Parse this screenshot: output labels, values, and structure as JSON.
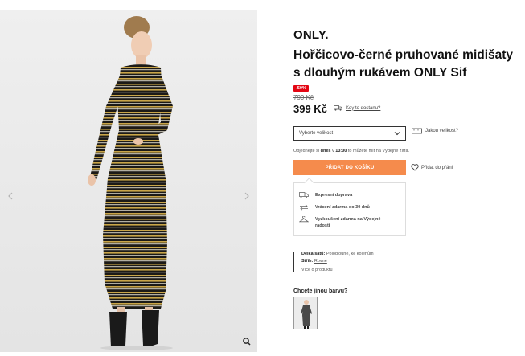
{
  "gallery": {
    "prev_icon": "chevron-left-icon",
    "next_icon": "chevron-right-icon",
    "zoom_icon": "magnifier-icon"
  },
  "product": {
    "brand": "ONLY.",
    "title": "Hořčicovo-černé pruhované midišaty s dlouhým rukávem ONLY Sif",
    "discount_badge": "-50%",
    "old_price": "799 Kč",
    "price": "399 Kč",
    "delivery_link": "Kdy to dostanu?"
  },
  "size": {
    "placeholder": "Vyberte velikost",
    "guide_link": "Jakou velikost?"
  },
  "order_note": {
    "prefix": "Objednejte si ",
    "today": "dnes",
    "middle": " v ",
    "time": "13:00",
    "after": " to ",
    "link": "můžete mít",
    "suffix": " na Výdejně zítra."
  },
  "actions": {
    "add_to_cart": "PŘIDAT DO KOŠÍKU",
    "favorite": "Přidat do přání"
  },
  "benefits": [
    {
      "icon": "truck-icon",
      "text": "Expresní doprava"
    },
    {
      "icon": "exchange-arrows-icon",
      "text": "Vrácení zdarma do 30 dnů"
    },
    {
      "icon": "hanger-icon",
      "text": "Vyzkoušení zdarma na Výdejně radosti"
    }
  ],
  "details": {
    "length_label": "Délka šatů:",
    "length_value": "Polodlouhé, ke kolenům",
    "sleeve_label": "Střih:",
    "sleeve_value": "Rovné",
    "more_link": "Více o produktu"
  },
  "other_colors": {
    "title": "Chcete jinou barvu?"
  },
  "colors": {
    "accent": "#f58b4c",
    "badge": "#e30613"
  }
}
